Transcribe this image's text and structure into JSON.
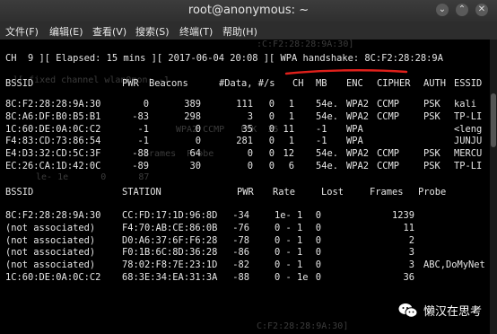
{
  "window": {
    "title": "root@anonymous: ~",
    "buttons": [
      "⌄",
      "⌃",
      "✕"
    ]
  },
  "menu": [
    "文件(F)",
    "编辑(E)",
    "查看(V)",
    "搜索(S)",
    "终端(T)",
    "帮助(H)"
  ],
  "status": {
    "line": "CH  9 ][ Elapsed: 15 mins ][ 2017-06-04 20:08 ][ WPA handshake: 8C:F2:28:28:9A"
  },
  "ap_table": {
    "headers": [
      "BSSID",
      "PWR",
      "Beacons",
      "#Data, #/s",
      "CH",
      "MB",
      "ENC",
      "CIPHER",
      "AUTH",
      "ESSID"
    ],
    "rows": [
      {
        "bssid": "8C:F2:28:28:9A:30",
        "pwr": "0",
        "beacons": "389",
        "data": "111",
        "s": "0",
        "ch": "1",
        "mb": "54e.",
        "enc": "WPA2",
        "cipher": "CCMP",
        "auth": "PSK",
        "essid": "kali"
      },
      {
        "bssid": "8C:A6:DF:B0:B5:B1",
        "pwr": "-83",
        "beacons": "298",
        "data": "3",
        "s": "0",
        "ch": "1",
        "mb": "54e.",
        "enc": "WPA2",
        "cipher": "CCMP",
        "auth": "PSK",
        "essid": "TP-LI"
      },
      {
        "bssid": "1C:60:DE:0A:0C:C2",
        "pwr": "-1",
        "beacons": "0",
        "data": "35",
        "s": "0",
        "ch": "11",
        "mb": "-1",
        "enc": "WPA",
        "cipher": "",
        "auth": "",
        "essid": "<leng"
      },
      {
        "bssid": "F4:83:CD:73:86:54",
        "pwr": "-1",
        "beacons": "0",
        "data": "281",
        "s": "0",
        "ch": "1",
        "mb": "-1",
        "enc": "WPA",
        "cipher": "",
        "auth": "",
        "essid": "JUNJU"
      },
      {
        "bssid": "E4:D3:32:CD:5C:3F",
        "pwr": "-88",
        "beacons": "64",
        "data": "0",
        "s": "0",
        "ch": "12",
        "mb": "54e.",
        "enc": "WPA2",
        "cipher": "CCMP",
        "auth": "PSK",
        "essid": "MERCU"
      },
      {
        "bssid": "EC:26:CA:1D:42:0C",
        "pwr": "-89",
        "beacons": "30",
        "data": "0",
        "s": "0",
        "ch": "6",
        "mb": "54e.",
        "enc": "WPA2",
        "cipher": "CCMP",
        "auth": "PSK",
        "essid": "TP-LI"
      }
    ]
  },
  "station_table": {
    "headers": [
      "BSSID",
      "STATION",
      "PWR",
      "Rate",
      "Lost",
      "Frames",
      "Probe"
    ],
    "rows": [
      {
        "bssid": "8C:F2:28:28:9A:30",
        "station": "CC:FD:17:1D:96:8D",
        "pwr": "-34",
        "rate": "1e- 1",
        "lost": "0",
        "frames": "1239",
        "probe": ""
      },
      {
        "bssid": "(not associated)",
        "station": "F4:70:AB:CE:86:0B",
        "pwr": "-76",
        "rate": "0 - 1",
        "lost": "0",
        "frames": "11",
        "probe": ""
      },
      {
        "bssid": "(not associated)",
        "station": "D0:A6:37:6F:F6:28",
        "pwr": "-78",
        "rate": "0 - 1",
        "lost": "0",
        "frames": "2",
        "probe": ""
      },
      {
        "bssid": "(not associated)",
        "station": "F0:1B:6C:8D:36:28",
        "pwr": "-86",
        "rate": "0 - 1",
        "lost": "0",
        "frames": "3",
        "probe": ""
      },
      {
        "bssid": "(not associated)",
        "station": "78:02:F8:7E:23:1D",
        "pwr": "-82",
        "rate": "0 - 1",
        "lost": "0",
        "frames": "3",
        "probe": "ABC,DoMyNet"
      },
      {
        "bssid": "1C:60:DE:0A:0C:C2",
        "station": "68:3E:34:EA:31:3A",
        "pwr": "-88",
        "rate": "0 - 1e",
        "lost": "0",
        "frames": "36",
        "probe": ""
      }
    ]
  },
  "ghost_text": [
    ":C:F2:28:28:9A:30]",
    "][ fixed channel wlan0mon: -1",
    "WPA2 CCMP   PSK  35",
    "frames  Probe",
    "le- 1e      0      87",
    "C:F2:28:28:9A:30]"
  ],
  "watermark": {
    "text": "懒汉在思考",
    "icon": "wechat-icon"
  },
  "colors": {
    "terminal_bg": "#000000",
    "terminal_fg": "#e6e6e6",
    "annotation": "#e0201b"
  }
}
